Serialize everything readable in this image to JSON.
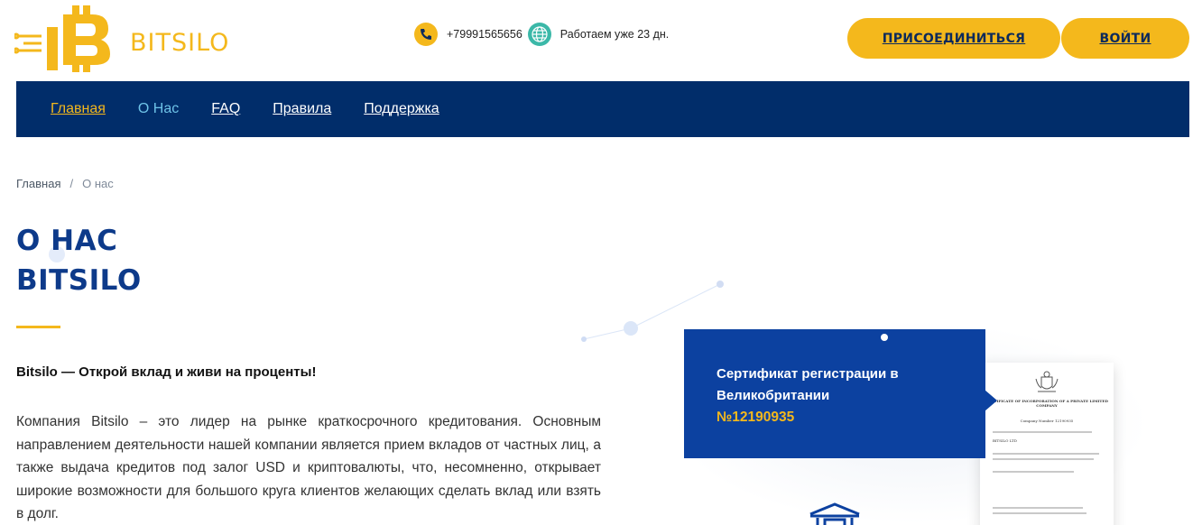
{
  "header": {
    "logo_text": "BITSILO",
    "phone": "+79991565656",
    "days_working": "Работаем уже 23 дн.",
    "join_label": "ПРИСОЕДИНИТЬСЯ",
    "login_label": "ВОЙТИ",
    "icons": [
      "phone-icon",
      "globe-icon"
    ]
  },
  "nav": {
    "items": [
      {
        "label": "Главная"
      },
      {
        "label": "О Нас"
      },
      {
        "label": "FAQ"
      },
      {
        "label": "Правила"
      },
      {
        "label": "Поддержка"
      }
    ]
  },
  "breadcrumb": {
    "home": "Главная",
    "separator": "/",
    "current": "О нас"
  },
  "main": {
    "title_line1": "О НАС",
    "title_line2": "BITSILO",
    "tagline": "Bitsilo — Открой вклад и живи на проценты!",
    "body": "Компания Bitsilo – это лидер на рынке краткосрочного кредитования. Основным направлением деятельности нашей компании является прием вкладов от частных лиц, а также выдача кредитов под залог USD и криптовалюты, что, несомненно, открывает широкие возможности для большого круга клиентов желающих сделать вклад или взять в долг."
  },
  "certificate": {
    "title": "Сертификат регистрации в Великобритании",
    "number": "№12190935",
    "doc_heading": "CERTIFICATE OF INCORPORATION OF A PRIVATE LIMITED COMPANY",
    "doc_company_number": "Company Number 12190935",
    "doc_company_name": "BITSILO LTD"
  },
  "colors": {
    "accent": "#f4b81c",
    "nav_bg": "#012d6a",
    "title": "#0d3a8a",
    "cert_bg": "#0c41a0",
    "nav_current": "#6ec3e8"
  }
}
